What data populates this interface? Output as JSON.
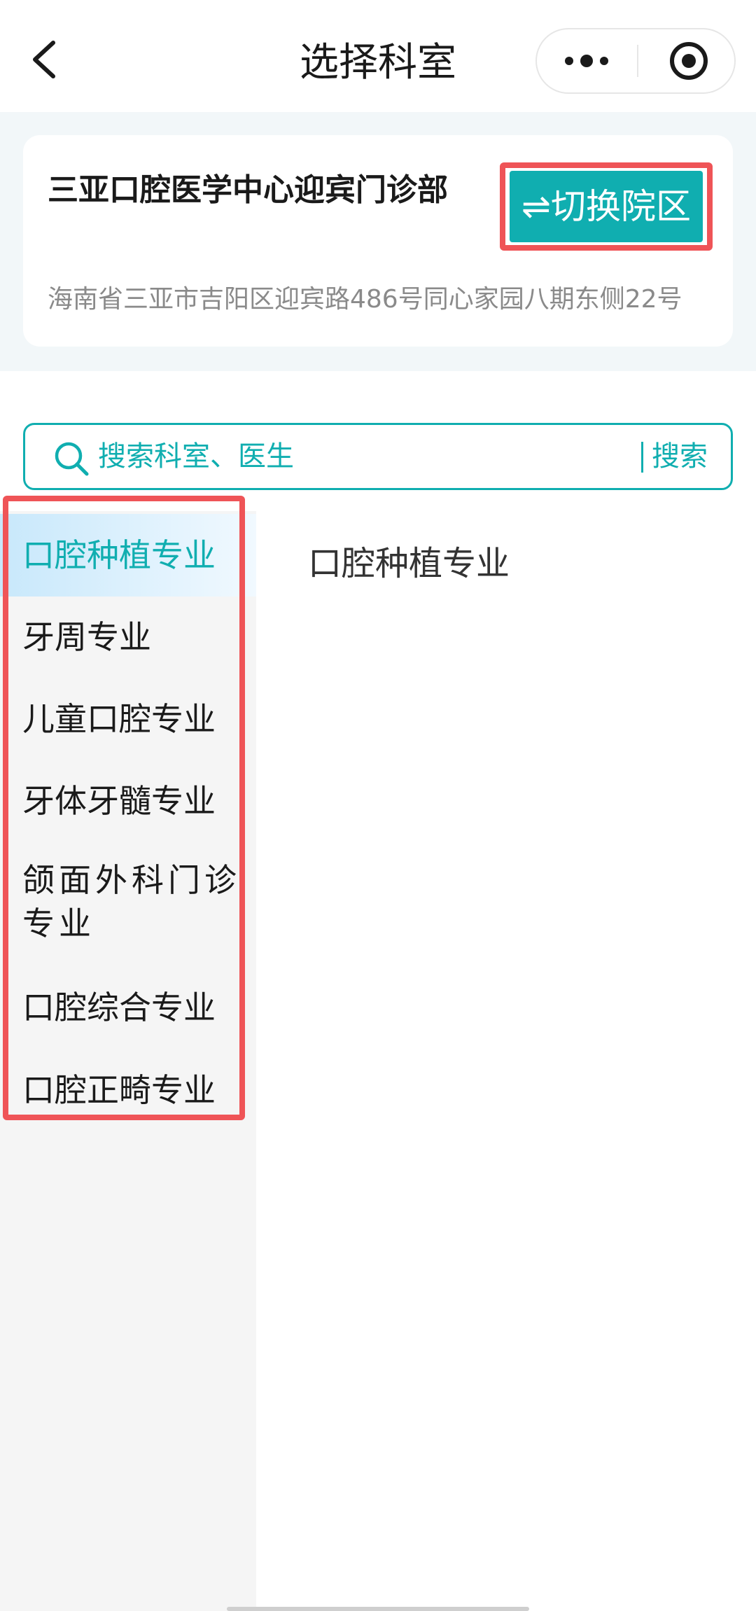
{
  "header": {
    "title": "选择科室",
    "back_icon": "chevron-left-icon",
    "more_icon": "more-dots-icon",
    "close_icon": "target-circle-icon"
  },
  "campus": {
    "name": "三亚口腔医学中心迎宾门诊部",
    "switch_label": "⇌切换院区",
    "address": "海南省三亚市吉阳区迎宾路486号同心家园八期东侧22号"
  },
  "search": {
    "placeholder": "搜索科室、医生",
    "button_label": "搜索"
  },
  "departments": [
    {
      "label": "口腔种植专业",
      "active": true
    },
    {
      "label": "牙周专业",
      "active": false
    },
    {
      "label": "儿童口腔专业",
      "active": false
    },
    {
      "label": "牙体牙髓专业",
      "active": false
    },
    {
      "label": "颌面外科门诊专业",
      "active": false
    },
    {
      "label": "口腔综合专业",
      "active": false
    },
    {
      "label": "口腔正畸专业",
      "active": false
    }
  ],
  "content": {
    "title": "口腔种植专业"
  },
  "colors": {
    "accent": "#10aeb0",
    "highlight_outline": "#ef5457",
    "active_item_bg": "#c8e8fb"
  }
}
